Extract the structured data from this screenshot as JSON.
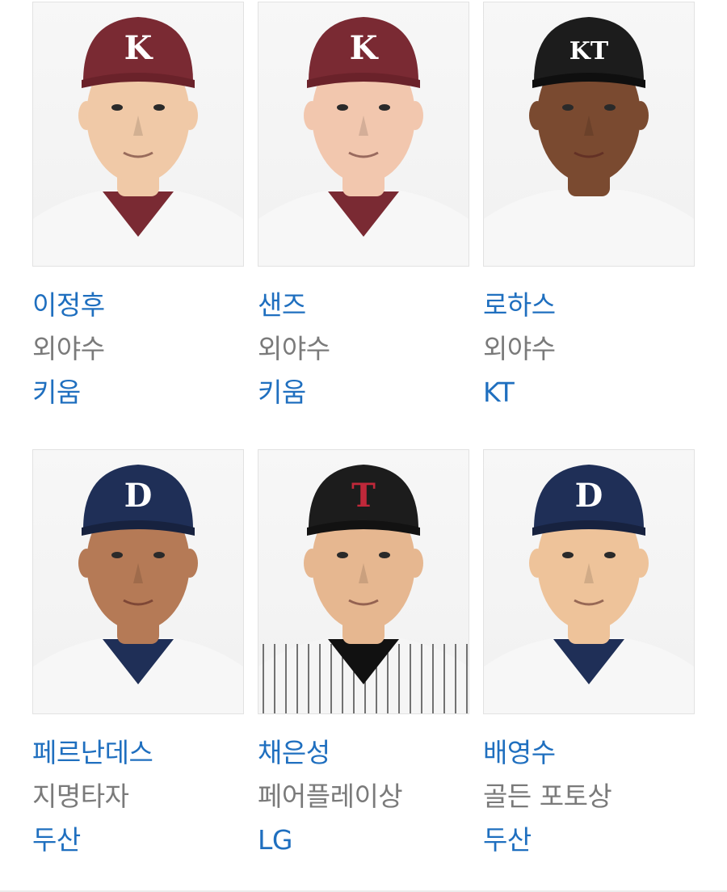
{
  "players": [
    {
      "name": "이정후",
      "award": "외야수",
      "team": "키움",
      "cap": {
        "color": "#7a2a33",
        "letter": "K",
        "letter_color": "#ffffff",
        "brim": "#6a222a"
      },
      "skin": "#f0c9a7",
      "jersey": {
        "color": "#f7f7f7",
        "collar": "#7a2a33",
        "stripes": false
      },
      "icon": "player-photo"
    },
    {
      "name": "샌즈",
      "award": "외야수",
      "team": "키움",
      "cap": {
        "color": "#7a2a33",
        "letter": "K",
        "letter_color": "#ffffff",
        "brim": "#6a222a"
      },
      "skin": "#f2c7ae",
      "jersey": {
        "color": "#f7f7f7",
        "collar": "#7a2a33",
        "stripes": false
      },
      "icon": "player-photo"
    },
    {
      "name": "로하스",
      "award": "외야수",
      "team": "KT",
      "cap": {
        "color": "#1c1c1c",
        "letter": "KT",
        "letter_color": "#ffffff",
        "brim": "#0f0f0f"
      },
      "skin": "#7a4a30",
      "jersey": {
        "color": "#f7f7f7",
        "collar": "#f7f7f7",
        "stripes": false
      },
      "icon": "player-photo"
    },
    {
      "name": "페르난데스",
      "award": "지명타자",
      "team": "두산",
      "cap": {
        "color": "#1f2f57",
        "letter": "D",
        "letter_color": "#ffffff",
        "brim": "#17223f"
      },
      "skin": "#b57a56",
      "jersey": {
        "color": "#f7f7f7",
        "collar": "#1f2f57",
        "stripes": false
      },
      "icon": "player-photo"
    },
    {
      "name": "채은성",
      "award": "페어플레이상",
      "team": "LG",
      "cap": {
        "color": "#1c1c1c",
        "letter": "T",
        "letter_color": "#c0283a",
        "brim": "#121212"
      },
      "skin": "#e6b790",
      "jersey": {
        "color": "#f5f5f5",
        "collar": "#111111",
        "stripes": true
      },
      "icon": "player-photo"
    },
    {
      "name": "배영수",
      "award": "골든 포토상",
      "team": "두산",
      "cap": {
        "color": "#1f2f57",
        "letter": "D",
        "letter_color": "#ffffff",
        "brim": "#17223f"
      },
      "skin": "#eec39a",
      "jersey": {
        "color": "#f7f7f7",
        "collar": "#1f2f57",
        "stripes": false
      },
      "icon": "player-photo"
    }
  ]
}
